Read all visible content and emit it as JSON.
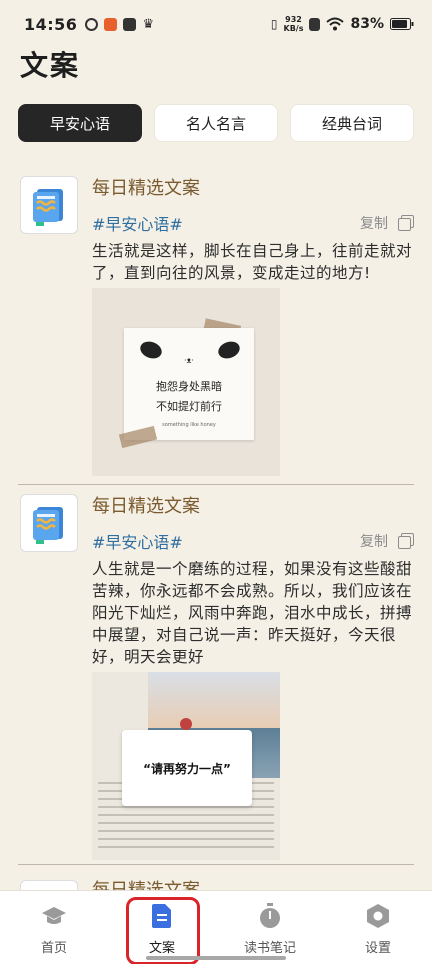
{
  "status_bar": {
    "time": "14:56",
    "speed_value": "932",
    "speed_unit": "KB/s",
    "battery": "83%"
  },
  "page": {
    "title": "文案"
  },
  "tabs": [
    {
      "label": "早安心语",
      "active": true
    },
    {
      "label": "名人名言",
      "active": false
    },
    {
      "label": "经典台词",
      "active": false
    }
  ],
  "posts": [
    {
      "title": "每日精选文案",
      "tag": "#早安心语#",
      "copy_label": "复制",
      "text": "生活就是这样，脚长在自己身上，往前走就对了，直到向往的风景，变成走过的地方!",
      "image": {
        "line1": "抱怨身处黑暗",
        "line2": "不如提灯前行",
        "line3": "something like honey"
      }
    },
    {
      "title": "每日精选文案",
      "tag": "#早安心语#",
      "copy_label": "复制",
      "text": "人生就是一个磨练的过程，如果没有这些酸甜苦辣，你永远都不会成熟。所以，我们应该在阳光下灿烂，风雨中奔跑，泪水中成长，拼搏中展望，对自己说一声：昨天挺好，今天很好，明天会更好",
      "image": {
        "card_text": "“请再努力一点”"
      }
    },
    {
      "title": "每日精选文案"
    }
  ],
  "bottom_nav": [
    {
      "label": "首页",
      "icon": "graduation-cap-icon",
      "active": false
    },
    {
      "label": "文案",
      "icon": "document-icon",
      "active": true
    },
    {
      "label": "读书笔记",
      "icon": "stopwatch-icon",
      "active": false
    },
    {
      "label": "设置",
      "icon": "hexagon-gear-icon",
      "active": false
    }
  ],
  "colors": {
    "background": "#f4f0e6",
    "active_tab": "#262626",
    "title_brown": "#7a5a2e",
    "hashtag_blue": "#2f6ea0",
    "nav_active_blue": "#3b6fe0",
    "highlight_red": "#d9252a"
  }
}
